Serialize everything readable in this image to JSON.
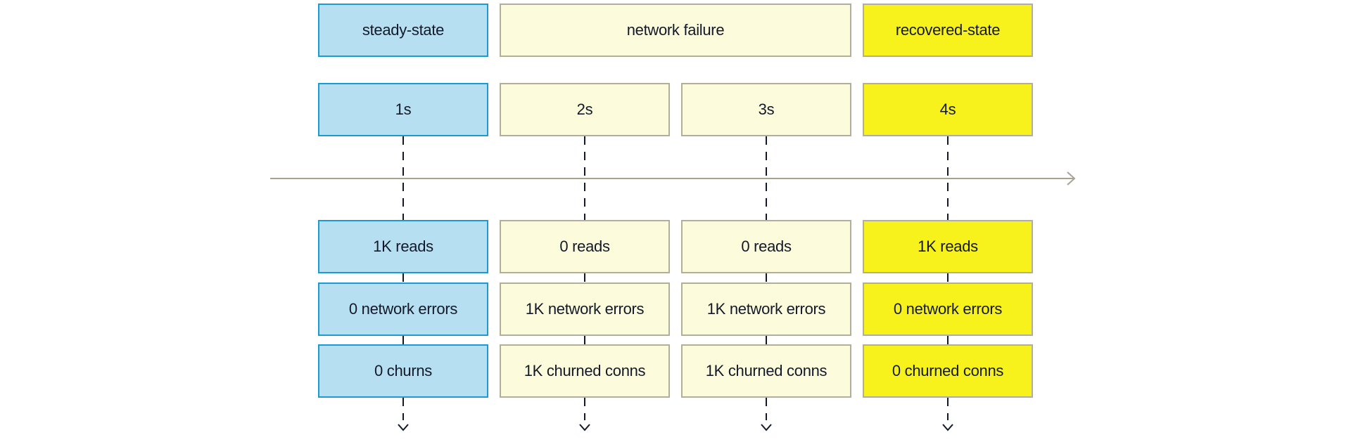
{
  "phases": [
    {
      "label": "steady-state",
      "style": "blue"
    },
    {
      "label": "network failure",
      "style": "pale"
    },
    {
      "label": "recovered-state",
      "style": "yel"
    }
  ],
  "columns": [
    {
      "time": "1s",
      "reads": "1K reads",
      "errors": "0 network errors",
      "churns": "0 churns",
      "style": "blue"
    },
    {
      "time": "2s",
      "reads": "0 reads",
      "errors": "1K network errors",
      "churns": "1K churned conns",
      "style": "pale"
    },
    {
      "time": "3s",
      "reads": "0 reads",
      "errors": "1K network errors",
      "churns": "1K churned conns",
      "style": "pale"
    },
    {
      "time": "4s",
      "reads": "1K reads",
      "errors": "0 network errors",
      "churns": "0 churned conns",
      "style": "yel"
    }
  ],
  "colors": {
    "steady": "#b6e0f2",
    "failure": "#fcfcdc",
    "recovered": "#f8f21c",
    "axis": "#a8a290"
  }
}
